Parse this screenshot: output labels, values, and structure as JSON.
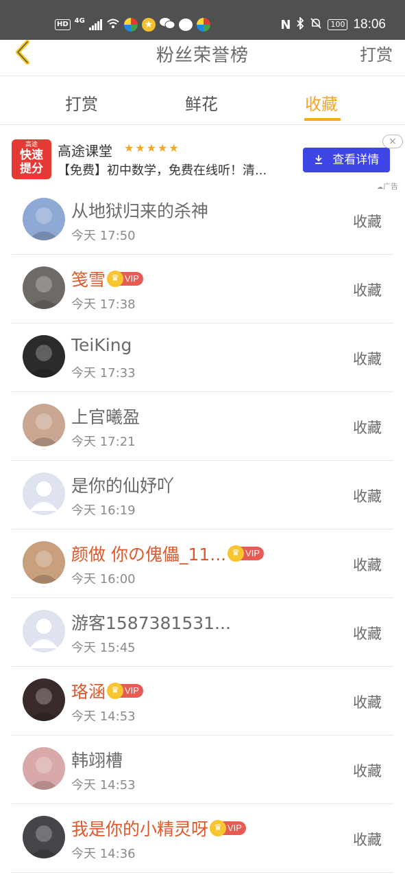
{
  "status_bar": {
    "hd": "HD",
    "network": "4G",
    "battery": "100",
    "time": "18:06"
  },
  "header": {
    "title": "粉丝荣誉榜",
    "right_label": "打赏"
  },
  "tabs": [
    {
      "label": "打赏",
      "active": false
    },
    {
      "label": "鲜花",
      "active": false
    },
    {
      "label": "收藏",
      "active": true
    }
  ],
  "ad": {
    "logo_small": "高途",
    "logo_big_1": "快速",
    "logo_big_2": "提分",
    "name": "高途课堂",
    "stars": "★★★★★",
    "description": "【免费】初中数学，免费在线听！清...",
    "button_label": "查看详情",
    "label": "广告",
    "close": "×"
  },
  "vip_label": "VIP",
  "list": [
    {
      "name": "从地狱归来的杀神",
      "time": "今天 17:50",
      "vip": false,
      "action": "收藏",
      "avatar_color": "#8fa9d6"
    },
    {
      "name": "笺雪",
      "time": "今天 17:38",
      "vip": true,
      "action": "收藏",
      "avatar_color": "#6e6a66"
    },
    {
      "name": "TeiKing",
      "time": "今天 17:33",
      "vip": false,
      "action": "收藏",
      "avatar_color": "#2b2b2b"
    },
    {
      "name": "上官曦盈",
      "time": "今天 17:21",
      "vip": false,
      "action": "收藏",
      "avatar_color": "#c9a793"
    },
    {
      "name": "是你的仙妤吖",
      "time": "今天 16:19",
      "vip": false,
      "action": "收藏",
      "avatar_color": "#dfe3f0"
    },
    {
      "name": "颜做 你の傀儡_11...",
      "time": "今天 16:00",
      "vip": true,
      "action": "收藏",
      "avatar_color": "#c9a07e"
    },
    {
      "name": "游客1587381531...",
      "time": "今天 15:45",
      "vip": false,
      "action": "收藏",
      "avatar_color": "#dfe3f0"
    },
    {
      "name": "珞涵",
      "time": "今天 14:53",
      "vip": true,
      "action": "收藏",
      "avatar_color": "#3a2a2a"
    },
    {
      "name": "韩翊槽",
      "time": "今天 14:53",
      "vip": false,
      "action": "收藏",
      "avatar_color": "#d9a9a9"
    },
    {
      "name": "我是你的小精灵呀",
      "time": "今天 14:36",
      "vip": true,
      "action": "收藏",
      "avatar_color": "#444649"
    }
  ]
}
